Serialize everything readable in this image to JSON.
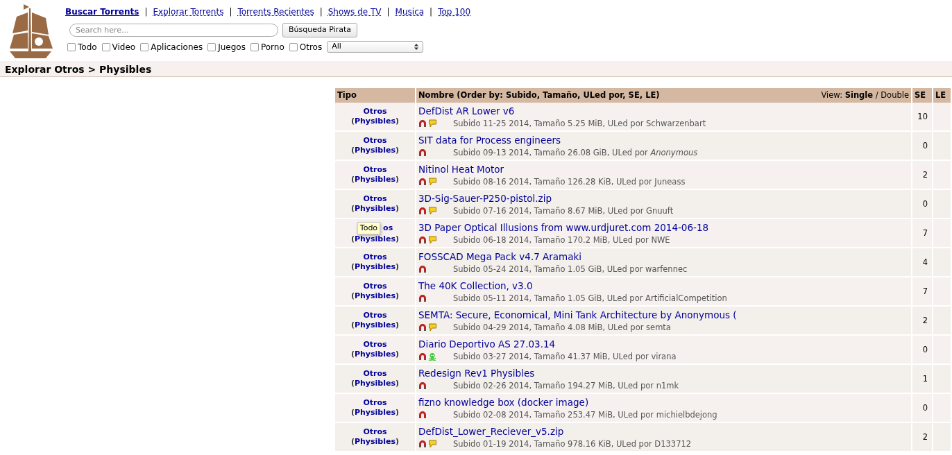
{
  "nav": [
    {
      "label": "Buscar Torrents",
      "selected": true
    },
    {
      "label": "Explorar Torrents",
      "selected": false
    },
    {
      "label": "Torrents Recientes",
      "selected": false
    },
    {
      "label": "Shows de TV",
      "selected": false
    },
    {
      "label": "Musica",
      "selected": false
    },
    {
      "label": "Top 100",
      "selected": false
    }
  ],
  "nav_separator": "|",
  "search": {
    "placeholder": "Search here...",
    "button": "Búsqueda Pirata"
  },
  "categories": [
    {
      "label": "Todo",
      "checked": false
    },
    {
      "label": "Video",
      "checked": false
    },
    {
      "label": "Aplicaciones",
      "checked": false
    },
    {
      "label": "Juegos",
      "checked": false
    },
    {
      "label": "Porno",
      "checked": false
    },
    {
      "label": "Otros",
      "checked": false
    }
  ],
  "category_select": "All",
  "breadcrumb": "Explorar Otros > Physibles",
  "table": {
    "columns": {
      "tipo": "Tipo",
      "nombre": "Nombre (Order by: Subido, Tamaño, ULed por, SE, LE)",
      "view_label": "View:",
      "view_options": [
        {
          "label": "Single",
          "selected": true
        },
        {
          "label": "Double",
          "selected": false
        }
      ],
      "view_separator": "/",
      "se": "SE",
      "le": "LE"
    },
    "rows": [
      {
        "type": "Otros",
        "subtype": "Physibles",
        "name": "DefDist AR Lower v6",
        "comments": true,
        "vip": false,
        "details": "Subido 11-25 2014, Tamaño 5.25 MiB, ULed por Schwarzenbart",
        "se": "10"
      },
      {
        "type": "Otros",
        "subtype": "Physibles",
        "name": "SIT data for Process engineers",
        "comments": false,
        "vip": false,
        "details": "Subido 09-13 2014, Tamaño 26.08 GiB, ULed por *Anonymous*",
        "se": "0"
      },
      {
        "type": "Otros",
        "subtype": "Physibles",
        "name": "Nitinol Heat Motor",
        "comments": true,
        "vip": false,
        "details": "Subido 08-16 2014, Tamaño 126.28 KiB, ULed por Juneass",
        "se": "2"
      },
      {
        "type": "Otros",
        "subtype": "Physibles",
        "name": "3D-Sig-Sauer-P250-pistol.zip",
        "comments": true,
        "vip": false,
        "details": "Subido 07-16 2014, Tamaño 8.67 MiB, ULed por Gnuuft",
        "se": "0"
      },
      {
        "tooltip": "Todo",
        "type": "os",
        "subtype": "Physibles",
        "name": "3D Paper Optical Illusions from www.urdjuret.com 2014-06-18",
        "comments": true,
        "vip": false,
        "details": "Subido 06-18 2014, Tamaño 170.2 MiB, ULed por NWE",
        "se": "7"
      },
      {
        "type": "Otros",
        "subtype": "Physibles",
        "name": "FOSSCAD Mega Pack v4.7 Aramaki",
        "comments": false,
        "vip": false,
        "details": "Subido 05-24 2014, Tamaño 1.05 GiB, ULed por warfennec",
        "se": "4"
      },
      {
        "type": "Otros",
        "subtype": "Physibles",
        "name": "The 40K Collection, v3.0",
        "comments": false,
        "vip": false,
        "details": "Subido 05-11 2014, Tamaño 1.05 GiB, ULed por ArtificialCompetition",
        "se": "7"
      },
      {
        "type": "Otros",
        "subtype": "Physibles",
        "name": "SEMTA: Secure, Economical, Mini Tank Architecture by Anonymous (",
        "comments": true,
        "vip": false,
        "details": "Subido 04-29 2014, Tamaño 4.08 MiB, ULed por semta",
        "se": "2"
      },
      {
        "type": "Otros",
        "subtype": "Physibles",
        "name": "Diario Deportivo AS 27.03.14",
        "comments": false,
        "vip": true,
        "details": "Subido 03-27 2014, Tamaño 41.37 MiB, ULed por virana",
        "se": "0"
      },
      {
        "type": "Otros",
        "subtype": "Physibles",
        "name": "Redesign Rev1 Physibles",
        "comments": false,
        "vip": false,
        "details": "Subido 02-26 2014, Tamaño 194.27 MiB, ULed por n1mk",
        "se": "1"
      },
      {
        "type": "Otros",
        "subtype": "Physibles",
        "name": "fizno knowledge box (docker image)",
        "comments": false,
        "vip": false,
        "details": "Subido 02-08 2014, Tamaño 253.47 MiB, ULed por michielbdejong",
        "se": "0"
      },
      {
        "type": "Otros",
        "subtype": "Physibles",
        "name": "DefDist_Lower_Reciever_v5.zip",
        "comments": true,
        "vip": false,
        "details": "Subido 01-19 2014, Tamaño 978.16 KiB, ULed por D133712",
        "se": "2"
      }
    ]
  },
  "brackets": [
    "(",
    ")"
  ]
}
